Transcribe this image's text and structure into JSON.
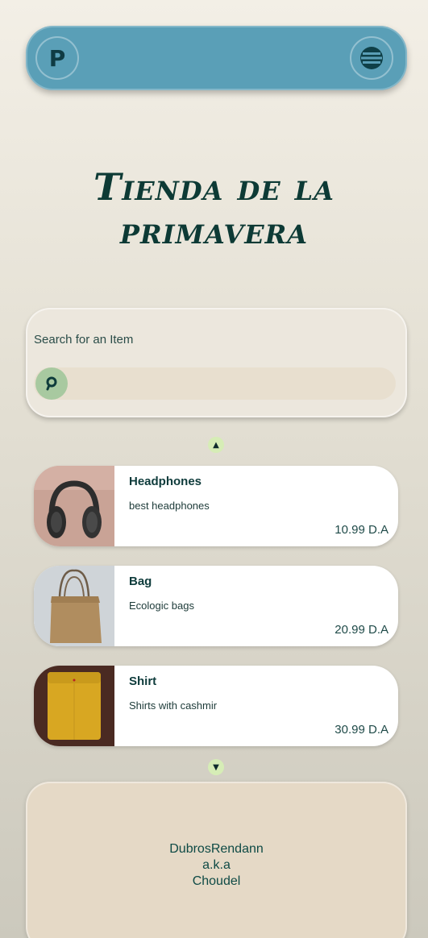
{
  "navbar": {
    "logo_letter": "P",
    "menu_icon": "hamburger-menu-icon"
  },
  "page_title": "Tienda de la primavera",
  "search": {
    "label": "Search for an Item",
    "placeholder": "",
    "value": "",
    "icon": "search-icon"
  },
  "scroll": {
    "up_glyph": "▲",
    "down_glyph": "▼"
  },
  "products": [
    {
      "name": "Headphones",
      "description": "best headphones",
      "price": "10.99 D.A",
      "image": "headphones-image"
    },
    {
      "name": "Bag",
      "description": "Ecologic bags",
      "price": "20.99 D.A",
      "image": "tote-bag-image"
    },
    {
      "name": "Shirt",
      "description": "Shirts with cashmir",
      "price": "30.99 D.A",
      "image": "yellow-shirt-image"
    }
  ],
  "footer": {
    "line1": "DubrosRendann",
    "line2": "a.k.a",
    "line3": "Choudel"
  },
  "colors": {
    "navbar": "#5a9fb7",
    "accent_green": "#d6edb6",
    "title": "#0d3a35"
  }
}
